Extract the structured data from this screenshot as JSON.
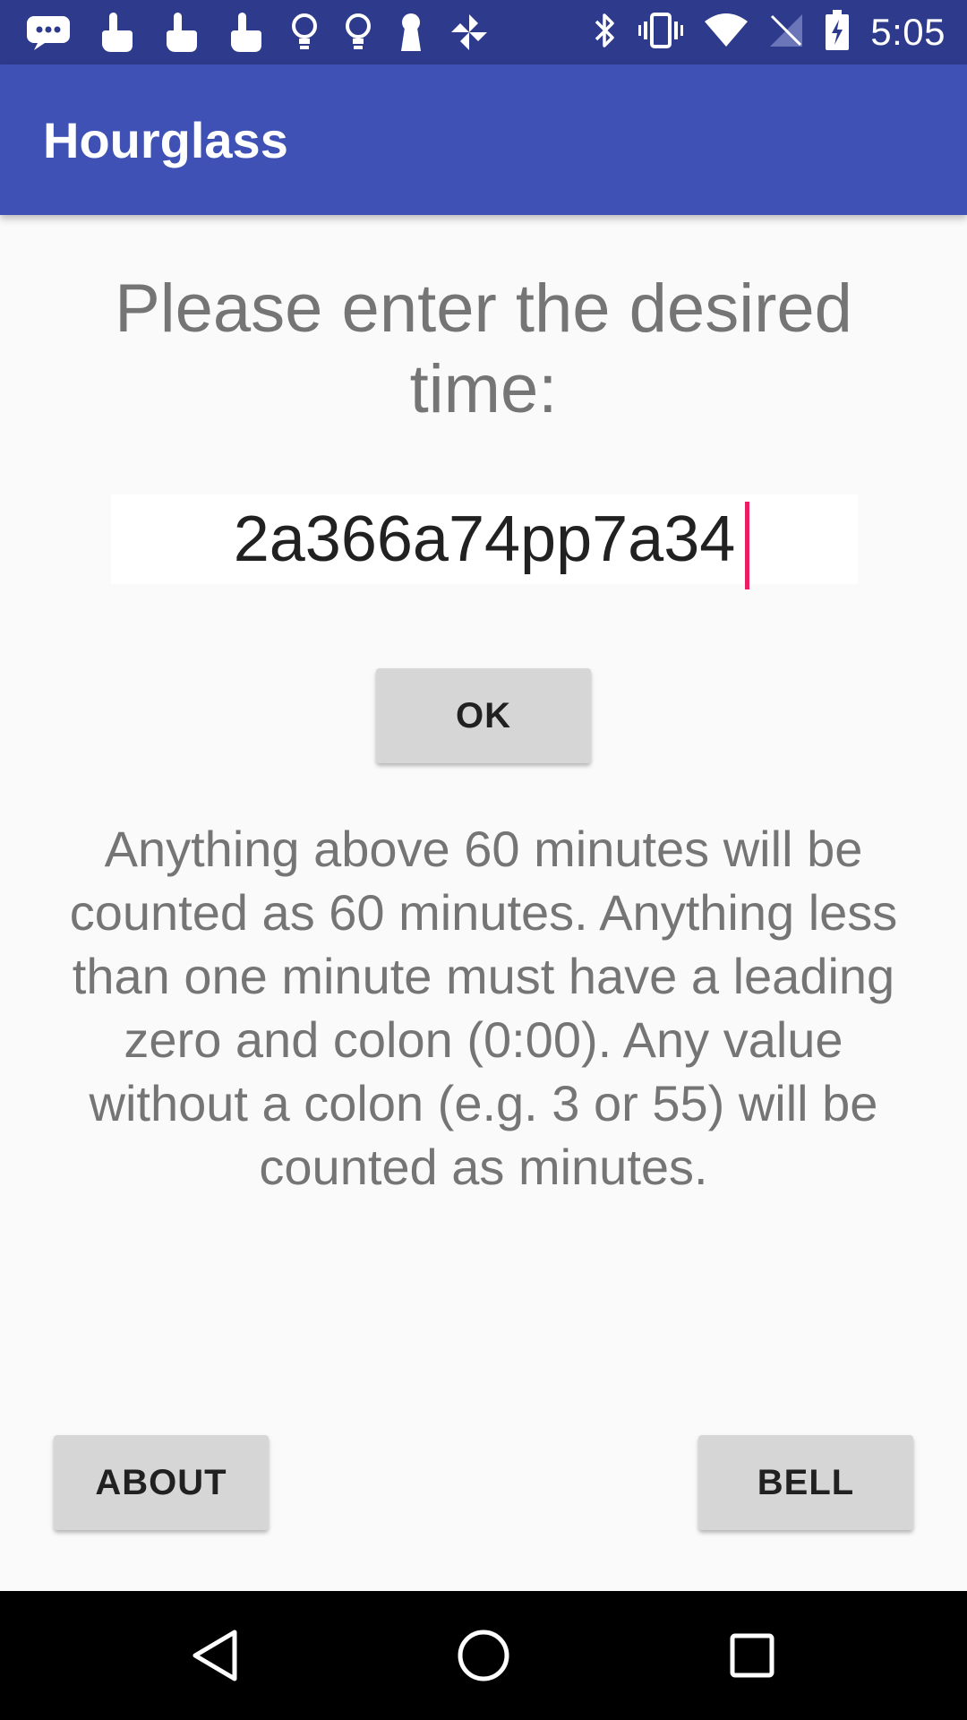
{
  "status_bar": {
    "time": "5:05",
    "left_icons": [
      "message-icon",
      "touch-icon",
      "touch-icon",
      "touch-icon",
      "bulb-icon",
      "bulb-icon",
      "keyhole-icon",
      "pinwheel-icon"
    ],
    "right_icons": [
      "bluetooth-icon",
      "vibrate-icon",
      "wifi-icon",
      "no-signal-icon",
      "battery-charging-icon"
    ]
  },
  "app_bar": {
    "title": "Hourglass",
    "color": "#3f51b5"
  },
  "main": {
    "prompt": "Please enter the desired time:",
    "time_input": {
      "value": "2a366a74pp7a34",
      "placeholder": ""
    },
    "ok_label": "OK",
    "info_text": "Anything above 60 minutes will be counted as 60 minutes. Anything less than one minute must have a leading zero and colon (0:00). Any value without a colon (e.g. 3 or 55) will be counted as minutes."
  },
  "footer": {
    "about_label": "ABOUT",
    "bell_label": "BELL"
  },
  "nav_bar": {
    "icons": [
      "back-icon",
      "home-icon",
      "recents-icon"
    ]
  },
  "colors": {
    "status_bar": "#2e3a8c",
    "accent": "#e91e63",
    "button": "#d6d6d6"
  }
}
